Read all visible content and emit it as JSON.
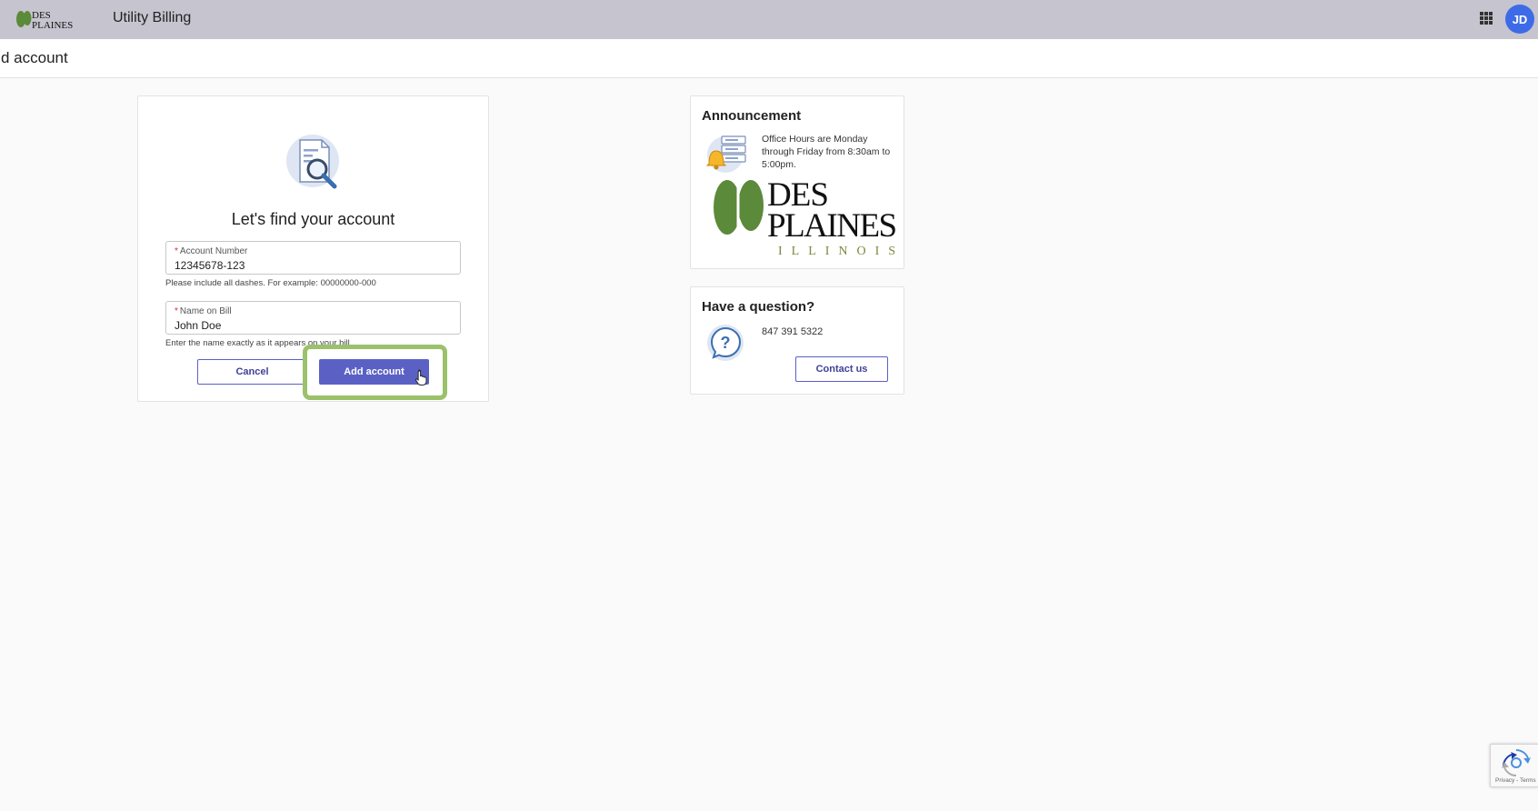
{
  "header": {
    "app_title": "Utility Billing",
    "avatar_initials": "JD"
  },
  "page": {
    "title": "d account"
  },
  "form": {
    "heading": "Let's find your account",
    "account_number": {
      "label": "Account Number",
      "required_marker": "*",
      "value": "12345678-123",
      "hint": "Please include all dashes. For example: 00000000-000"
    },
    "name_on_bill": {
      "label": "Name on Bill",
      "required_marker": "*",
      "value": "John Doe",
      "hint": "Enter the name exactly as it appears on your bill"
    },
    "cancel_label": "Cancel",
    "add_label": "Add account"
  },
  "announcement": {
    "title": "Announcement",
    "text": "Office Hours are Monday through Friday from 8:30am to 5:00pm.",
    "logo_text": "DES PLAINES ILLINOIS"
  },
  "question": {
    "title": "Have a question?",
    "phone": "847 391 5322",
    "contact_label": "Contact us"
  },
  "recaptcha": {
    "links": "Privacy - Terms"
  },
  "colors": {
    "topbar": "#c5c4cf",
    "primary": "#5b61c4",
    "highlight": "#9bc26b",
    "brand_green": "#5b8a3a",
    "avatar": "#3d6be8"
  }
}
